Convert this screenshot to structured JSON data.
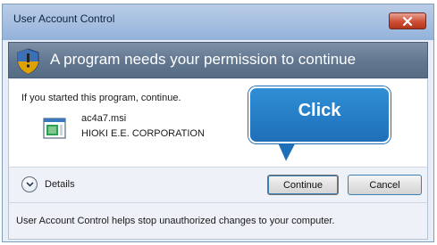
{
  "window": {
    "title": "User Account Control"
  },
  "banner": {
    "text": "A program needs your permission to continue"
  },
  "content": {
    "started_text": "If you started this program, continue.",
    "file_name": "ac4a7.msi",
    "publisher": "HIOKI E.E. CORPORATION"
  },
  "details": {
    "label": "Details"
  },
  "buttons": {
    "continue": "Continue",
    "cancel": "Cancel"
  },
  "footer": {
    "text": "User Account Control helps stop unauthorized changes to your computer."
  },
  "callout": {
    "text": "Click"
  }
}
